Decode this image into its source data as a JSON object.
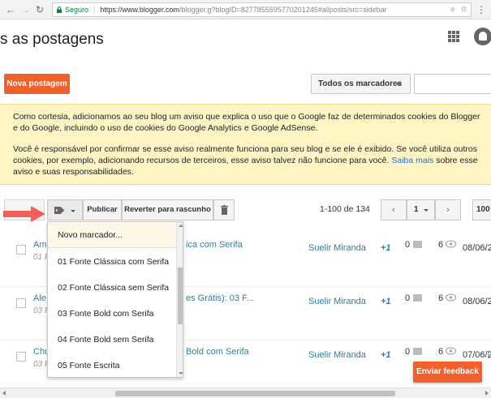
{
  "browser": {
    "secure_label": "Seguro",
    "url_domain": "https://www.blogger.com",
    "url_path": "/blogger.g?blogID=8277855595770201245#allposts/src=sidebar"
  },
  "header": {
    "title": "s as postagens"
  },
  "toolbar": {
    "new_post_label": "Nova postagem",
    "labels_filter": "Todos os marcadores",
    "publish_label": "Publicar",
    "revert_label": "Reverter para rascunho",
    "page_count": "1-100 de 134",
    "page_number": "1",
    "per_page": "100"
  },
  "notice": {
    "paragraph1": "Como cortesia, adicionamos ao seu blog um aviso que explica o uso que o Google faz de determinados cookies do Blogger e do Google, incluindo o uso de cookies do Google Analytics e Google AdSense.",
    "paragraph2_start": "Você é responsável por confirmar se esse aviso realmente funciona para seu blog e se ele é exibido. Se você utiliza outros cookies, por exemplo, adicionando recursos de terceiros, esse aviso talvez não funcione para você.",
    "learn_more": "Saiba mais",
    "paragraph2_end": "sobre esse aviso e suas responsabilidades."
  },
  "label_menu": {
    "items": [
      "Novo marcador...",
      "01 Fonte Clássica com Serifa",
      "02 Fonte Clássica sem Serifa",
      "03 Fonte Bold com Serifa",
      "04 Fonte Bold sem Serifa",
      "05 Fonte Escrita"
    ]
  },
  "posts": [
    {
      "title_head": "Am",
      "title_tail": "ica com Serifa",
      "sub": "01 F",
      "author": "Suelir Miranda",
      "plus": "+1",
      "comments": "0",
      "views": "6",
      "date": "08/06/2"
    },
    {
      "title_head": "Ale",
      "title_tail": "es Grátis): 03 F...",
      "sub": "03 F",
      "author": "Suelir Miranda",
      "plus": "+1",
      "comments": "0",
      "views": "6",
      "date": "08/06/2"
    },
    {
      "title_head": "Chu",
      "title_tail": "Bold com Serifa",
      "sub": "03 F",
      "author": "Suelir Miranda",
      "plus": "+1",
      "comments": "0",
      "views": "6",
      "date": "07/06/2"
    }
  ],
  "feedback": {
    "label": "Enviar feedback"
  },
  "colors": {
    "accent": "#f0612e",
    "link": "#2f7f9a",
    "notice_bg": "#fff5c4"
  }
}
